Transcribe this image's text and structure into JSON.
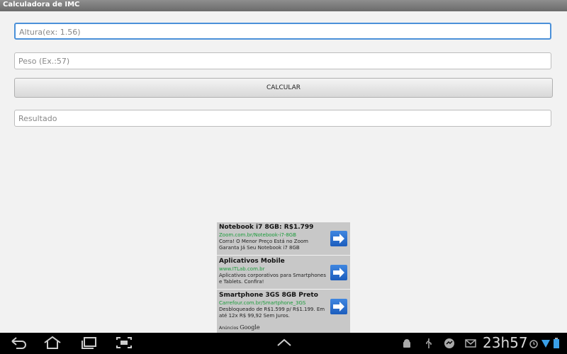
{
  "app": {
    "title": "Calculadora de IMC"
  },
  "form": {
    "height_placeholder": "Altura(ex: 1.56)",
    "weight_placeholder": "Peso (Ex.:57)",
    "calculate_label": "CALCULAR",
    "result_placeholder": "Resultado"
  },
  "ads": {
    "items": [
      {
        "title": "Notebook i7 8GB: R$1.799",
        "url": "Zoom.com.br/Notebook-i7-8GB",
        "desc": "Corra! O Menor Preço Está no Zoom Garanta Já Seu Notebook i7 8GB"
      },
      {
        "title": "Aplicativos Mobile",
        "url": "www.ITLab.com.br",
        "desc": "Aplicativos corporativos para Smartphones e Tablets. Confira!"
      },
      {
        "title": "Smartphone 3GS 8GB Preto",
        "url": "Carrefour.com.br/Smartphone_3GS",
        "desc": "Desbloqueado de R$1.599 p/ R$1.199. Em até 12x R$ 99,92 Sem Juros."
      }
    ],
    "footer_prefix": "Anúncios",
    "footer_brand": "Google"
  },
  "statusbar": {
    "time": "23h57"
  },
  "colors": {
    "accent": "#4a90d9",
    "ad_url": "#1a9b3a",
    "ad_arrow": "#2a6fd0"
  }
}
